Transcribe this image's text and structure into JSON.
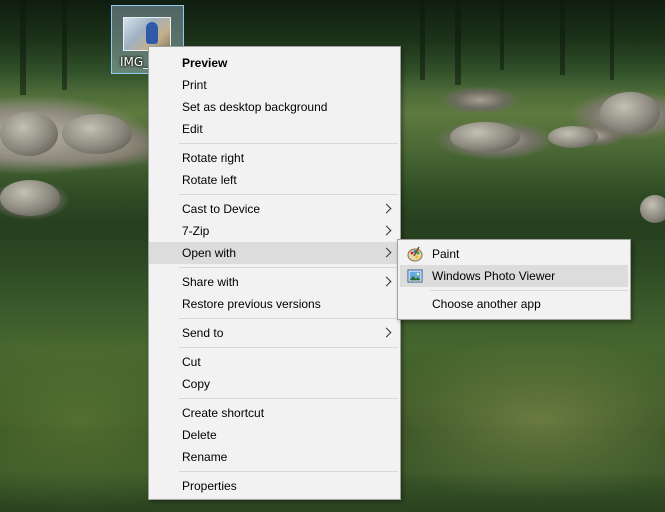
{
  "desktop": {
    "icon": {
      "label": "IMG_"
    }
  },
  "context_menu": {
    "items": [
      {
        "label": "Preview"
      },
      {
        "label": "Print"
      },
      {
        "label": "Set as desktop background"
      },
      {
        "label": "Edit"
      },
      {
        "label": "Rotate right"
      },
      {
        "label": "Rotate left"
      },
      {
        "label": "Cast to Device"
      },
      {
        "label": "7-Zip"
      },
      {
        "label": "Open with"
      },
      {
        "label": "Share with"
      },
      {
        "label": "Restore previous versions"
      },
      {
        "label": "Send to"
      },
      {
        "label": "Cut"
      },
      {
        "label": "Copy"
      },
      {
        "label": "Create shortcut"
      },
      {
        "label": "Delete"
      },
      {
        "label": "Rename"
      },
      {
        "label": "Properties"
      }
    ]
  },
  "open_with_submenu": {
    "items": [
      {
        "label": "Paint",
        "icon": "paint-palette-icon"
      },
      {
        "label": "Windows Photo Viewer",
        "icon": "photo-viewer-icon"
      },
      {
        "label": "Choose another app"
      }
    ]
  },
  "colors": {
    "menu_background": "#f2f2f2",
    "highlight": "#dcdcdc",
    "border": "#a0a0a0"
  }
}
